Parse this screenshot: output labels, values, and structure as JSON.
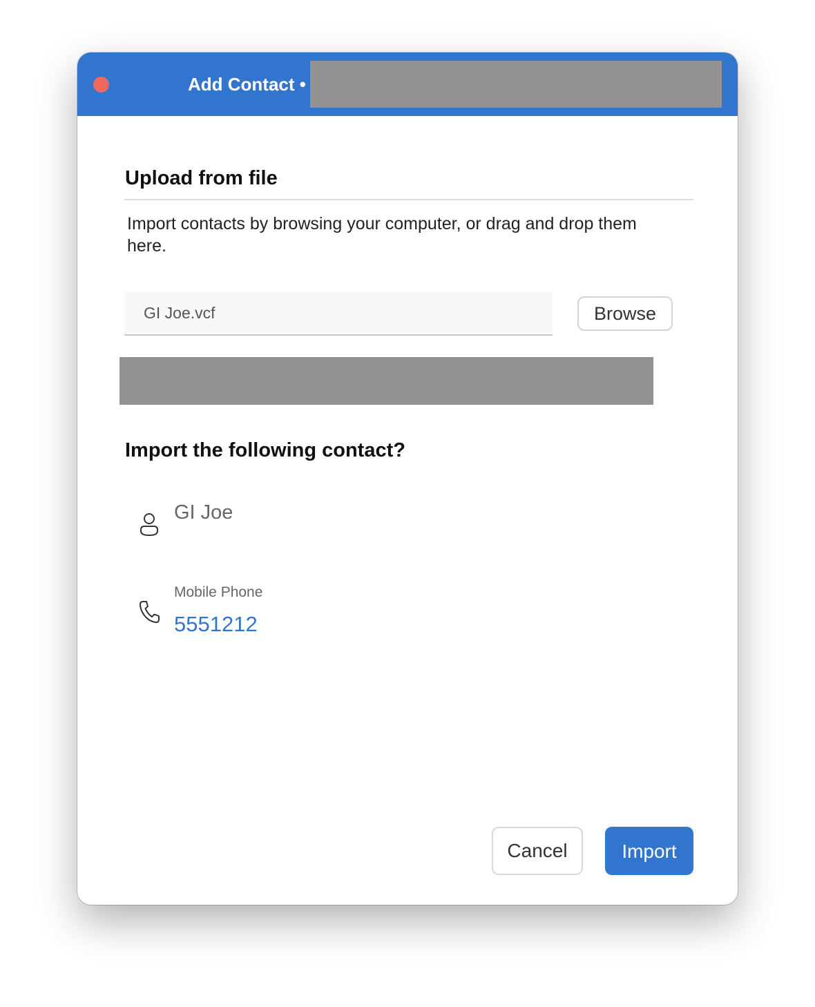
{
  "window": {
    "title": "Add Contact •"
  },
  "upload": {
    "heading": "Upload from file",
    "description": "Import contacts by browsing your computer, or drag and drop them here.",
    "file_name": "GI Joe.vcf",
    "browse_label": "Browse"
  },
  "preview": {
    "heading": "Import the following contact?",
    "contact_name": "GI Joe",
    "contact_icon": "person-icon",
    "phone_icon": "phone-icon",
    "phone_label": "Mobile Phone",
    "phone_number": "5551212"
  },
  "actions": {
    "cancel_label": "Cancel",
    "import_label": "Import"
  },
  "colors": {
    "accent": "#3275cf",
    "close_button": "#ee6a5e",
    "redaction": "#929292"
  }
}
